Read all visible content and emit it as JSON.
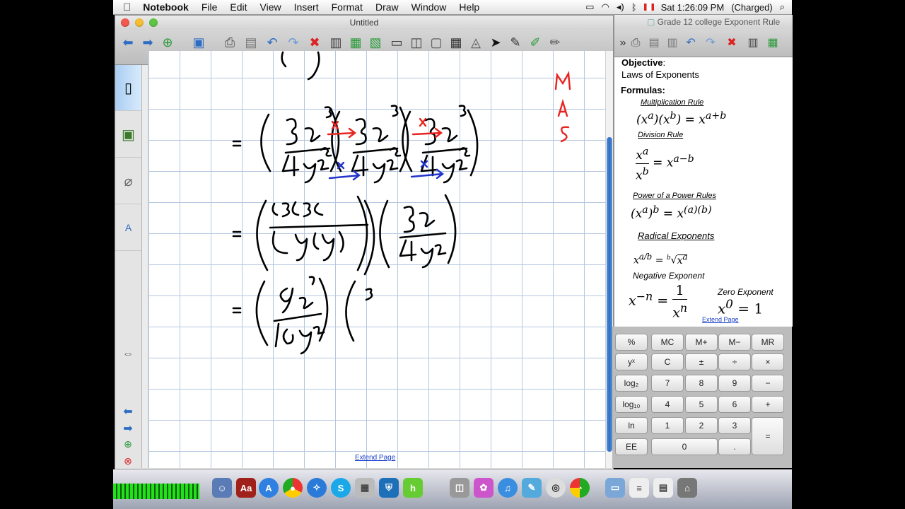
{
  "menubar": {
    "apple": "",
    "app": "Notebook",
    "items": [
      "File",
      "Edit",
      "View",
      "Insert",
      "Format",
      "Draw",
      "Window",
      "Help"
    ],
    "clock": "Sat 1:26:09 PM",
    "battery": "(Charged)"
  },
  "window": {
    "title": "Untitled",
    "extend_page": "Extend Page"
  },
  "gallery": {
    "title": "Grade 12 college Exponent Rule",
    "objective_label": "Objective",
    "objective_colon": ":",
    "objective_text": "Laws of Exponents",
    "formulas_label": "Formulas:",
    "rules": {
      "multiplication": "Multiplication Rule",
      "division": "Division Rule",
      "power": "Power of a Power Rules",
      "radical": "Radical Exponents",
      "negative": "Negative Exponent",
      "zero": "Zero Exponent"
    },
    "extend_page": "Extend Page"
  },
  "calculator": {
    "rows": [
      [
        "%",
        "MC",
        "M+",
        "M−",
        "MR"
      ],
      [
        "yˣ",
        "C",
        "±",
        "÷",
        "×"
      ],
      [
        "log₂",
        "7",
        "8",
        "9",
        "−"
      ],
      [
        "log₁₀",
        "4",
        "5",
        "6",
        "+"
      ],
      [
        "ln",
        "1",
        "2",
        "3"
      ],
      [
        "EE",
        "0",
        ".",
        "="
      ]
    ]
  },
  "colors": {
    "accent": "#2d6cc4",
    "ink": "#000000",
    "red": "#e8231f",
    "blue": "#2233cc"
  }
}
